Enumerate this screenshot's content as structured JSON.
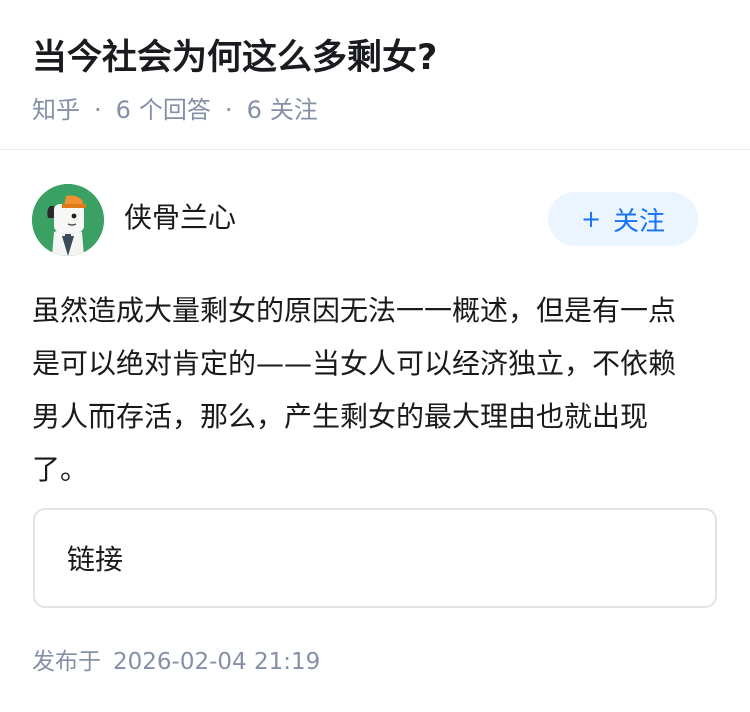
{
  "question": {
    "title": "当今社会为何这么多剩女?",
    "source": "知乎",
    "answer_count": "6",
    "answer_count_label": "个回答",
    "follower_count": "6",
    "follower_count_label": "关注"
  },
  "answer": {
    "author": {
      "name": "侠骨兰心",
      "avatar_icon": "cartoon-avatar-icon"
    },
    "follow_button": {
      "icon": "+",
      "label": "关注"
    },
    "content": "虽然造成大量剩女的原因无法一一概述，但是有一点是可以绝对肯定的——当女人可以经济独立，不依赖男人而存活，那么，产生剩女的最大理由也就出现了。",
    "link_card": {
      "label": "链接"
    },
    "published": {
      "label": "发布于",
      "time": "2026-02-04 21:19"
    }
  },
  "colors": {
    "meta_text": "#8590a6",
    "follow_bg": "#ebf5ff",
    "follow_text": "#1772f6",
    "avatar_bg": "#3aa064"
  }
}
